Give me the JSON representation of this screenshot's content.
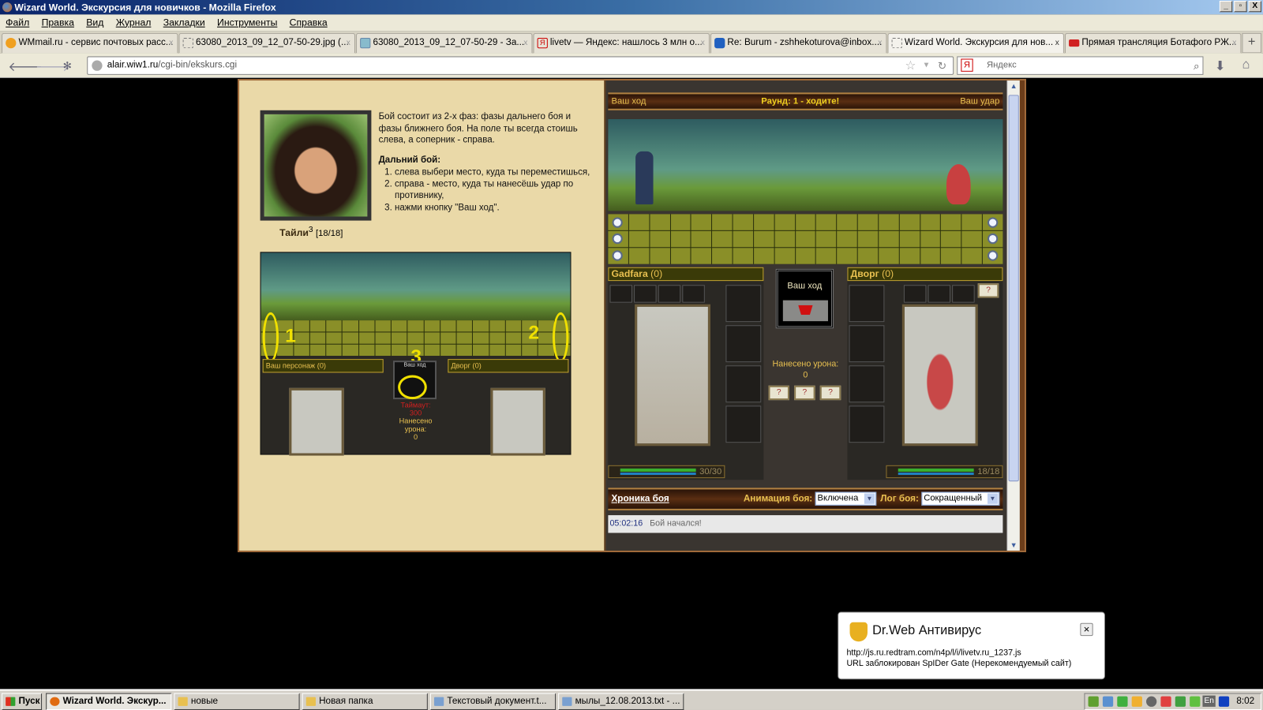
{
  "window": {
    "title": "Wizard World. Экскурсия для новичков - Mozilla Firefox",
    "buttons": [
      "_",
      "▫",
      "X"
    ]
  },
  "menu": [
    "Файл",
    "Правка",
    "Вид",
    "Журнал",
    "Закладки",
    "Инструменты",
    "Справка"
  ],
  "tabs": [
    {
      "label": "WMmail.ru - сервис почтовых расс...",
      "icon": "wmmail-icon"
    },
    {
      "label": "63080_2013_09_12_07-50-29.jpg (...",
      "icon": "image-icon"
    },
    {
      "label": "63080_2013_09_12_07-50-29 - За...",
      "icon": "image-icon"
    },
    {
      "label": "livetv — Яндекс: нашлось 3 млн о...",
      "icon": "yandex-icon"
    },
    {
      "label": "Re: Burum - zshhekoturova@inbox....",
      "icon": "mail-icon"
    },
    {
      "label": "Wizard World. Экскурсия для нов...",
      "icon": "page-icon",
      "active": true
    },
    {
      "label": "Прямая трансляция Ботафого РЖ...",
      "icon": "live-icon"
    }
  ],
  "tab_close": "x",
  "tab_add": "+",
  "nav": {
    "url_host": "alair.wiw1.ru",
    "url_path": "/cgi-bin/ekskurs.cgi",
    "search_placeholder": "Яндекс",
    "search_logo": "Я"
  },
  "tutorial": {
    "intro": "Бой состоит из 2-х фаз: фазы дальнего боя и фазы ближнего боя. На поле ты всегда стоишь слева, а соперник - справа.",
    "heading": "Дальний бой:",
    "steps": [
      "слева выбери место, куда ты переместишься,",
      "справа - место, куда ты нанесёшь удар по противнику,",
      "нажми кнопку \"Ваш ход\"."
    ],
    "npc_name": "Тайли",
    "npc_level": "3",
    "npc_hp": "[18/18]",
    "mini": {
      "marker1": "1",
      "marker2": "2",
      "marker3": "3",
      "player": "Ваш персонаж",
      "player_score": "(0)",
      "enemy": "Дворг",
      "enemy_score": "(0)",
      "button": "Ваш ход",
      "timeout_label": "Таймаут:",
      "timeout": "300",
      "damage_label": "Нанесено урона:",
      "damage": "0"
    }
  },
  "battle": {
    "left_label": "Ваш ход",
    "round": "Раунд: 1 - ходите!",
    "right_label": "Ваш удар",
    "player": {
      "name": "Gadfara",
      "score": "(0)",
      "hp": "30/30",
      "hp_fraction": 1.0
    },
    "enemy": {
      "name": "Дворг",
      "score": "(0)",
      "hp": "18/18",
      "hp_fraction": 1.0
    },
    "turn_button": "Ваш ход",
    "damage_label": "Нанесено урона:",
    "damage": "0",
    "unknown": "?",
    "chronicle": "Хроника боя",
    "anim_label": "Анимация боя:",
    "anim_value": "Включена",
    "log_label": "Лог боя:",
    "log_value": "Сокращенный",
    "log": [
      {
        "time": "05:02:16",
        "text": "Бой начался!"
      }
    ]
  },
  "popup": {
    "title": "Dr.Web Антивирус",
    "line1": "http://js.ru.redtram.com/n4p/l/i/livetv.ru_1237.js",
    "line2": "URL заблокирован SpIDer Gate (Нерекомендуемый сайт)",
    "close": "×"
  },
  "taskbar": {
    "start": "Пуск",
    "items": [
      "Wizard World. Экскур...",
      "новые",
      "Новая папка",
      "Текстовый документ.t...",
      "мылы_12.08.2013.txt - ..."
    ],
    "lang": "En",
    "clock": "8:02"
  },
  "colors": {
    "accent_gold": "#e8c050",
    "timeout_red": "#d02020",
    "title_blue": "#0a246a"
  }
}
